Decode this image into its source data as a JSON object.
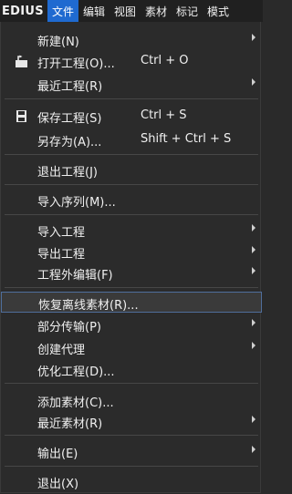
{
  "menubar": {
    "brand": "EDIUS",
    "items": [
      "文件",
      "编辑",
      "视图",
      "素材",
      "标记",
      "模式"
    ]
  },
  "file_menu": {
    "new": "新建(N)",
    "open": "打开工程(O)...",
    "open_shortcut": "Ctrl + O",
    "recent_projects": "最近工程(R)",
    "save": "保存工程(S)",
    "save_shortcut": "Ctrl + S",
    "save_as": "另存为(A)...",
    "save_as_shortcut": "Shift + Ctrl + S",
    "exit_project": "退出工程(J)",
    "import_sequence": "导入序列(M)...",
    "import_project": "导入工程",
    "export_project": "导出工程",
    "external_edit": "工程外编辑(F)",
    "restore_offline": "恢复离线素材(R)...",
    "partial_transfer": "部分传输(P)",
    "create_proxy": "创建代理",
    "optimize_project": "优化工程(D)...",
    "add_clip": "添加素材(C)...",
    "recent_clips": "最近素材(R)",
    "output": "输出(E)",
    "exit": "退出(X)"
  },
  "colors": {
    "active_menu": "#1f6ad0",
    "menu_bg": "#2b2b2b",
    "hover_border": "#4f6e9c"
  }
}
